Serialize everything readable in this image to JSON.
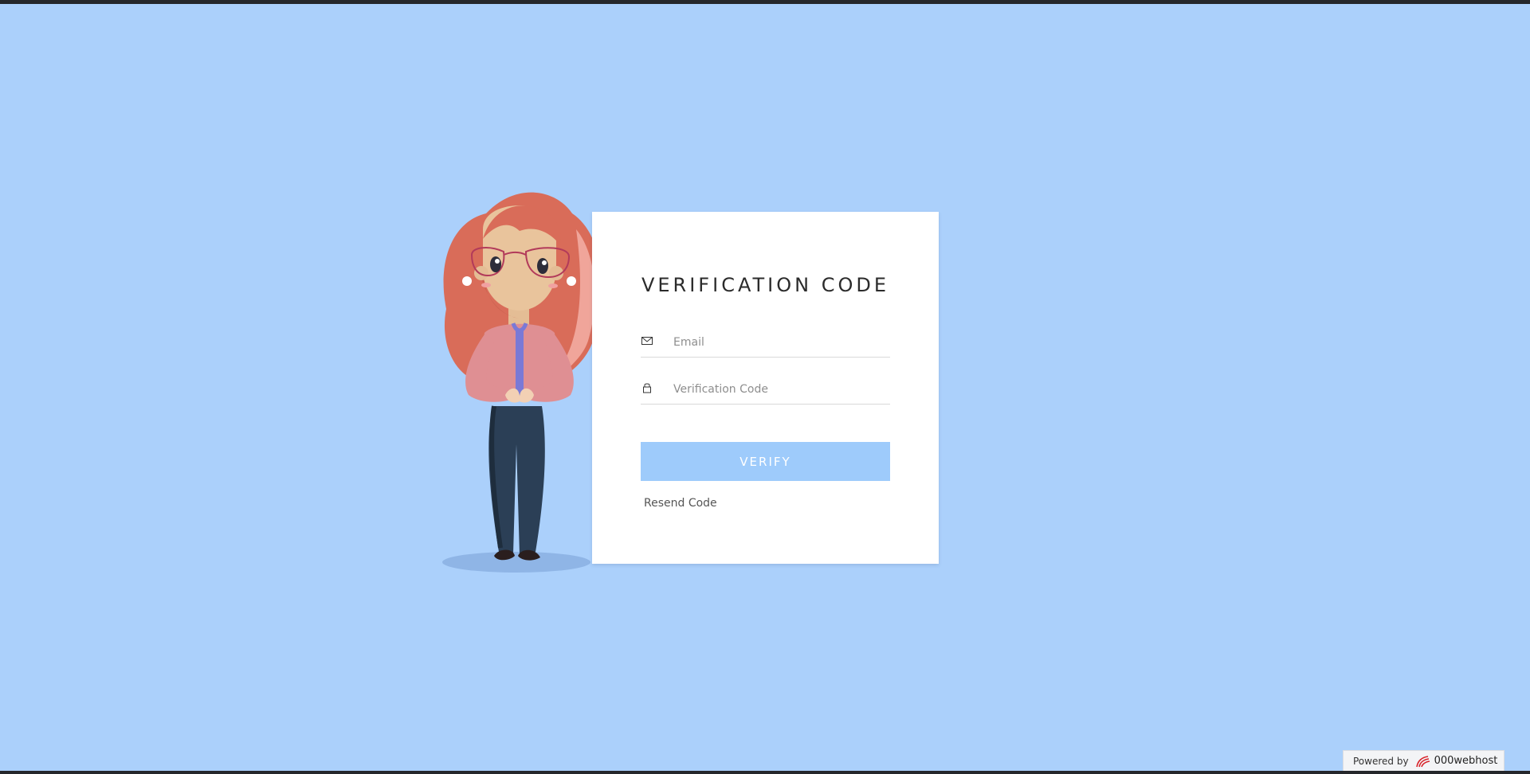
{
  "colors": {
    "background": "#abd0fb",
    "card": "#ffffff",
    "button": "#9ecbfb",
    "title": "#2b2b2b"
  },
  "form": {
    "title": "VERIFICATION CODE",
    "email": {
      "icon": "envelope-icon",
      "placeholder": "Email",
      "value": ""
    },
    "code": {
      "icon": "lock-icon",
      "placeholder": "Verification Code",
      "value": ""
    },
    "verify_label": "VERIFY",
    "resend_label": "Resend Code"
  },
  "footer": {
    "powered_label": "Powered by",
    "brand": "000webhost",
    "logo_icon": "000webhost-logo-icon"
  }
}
